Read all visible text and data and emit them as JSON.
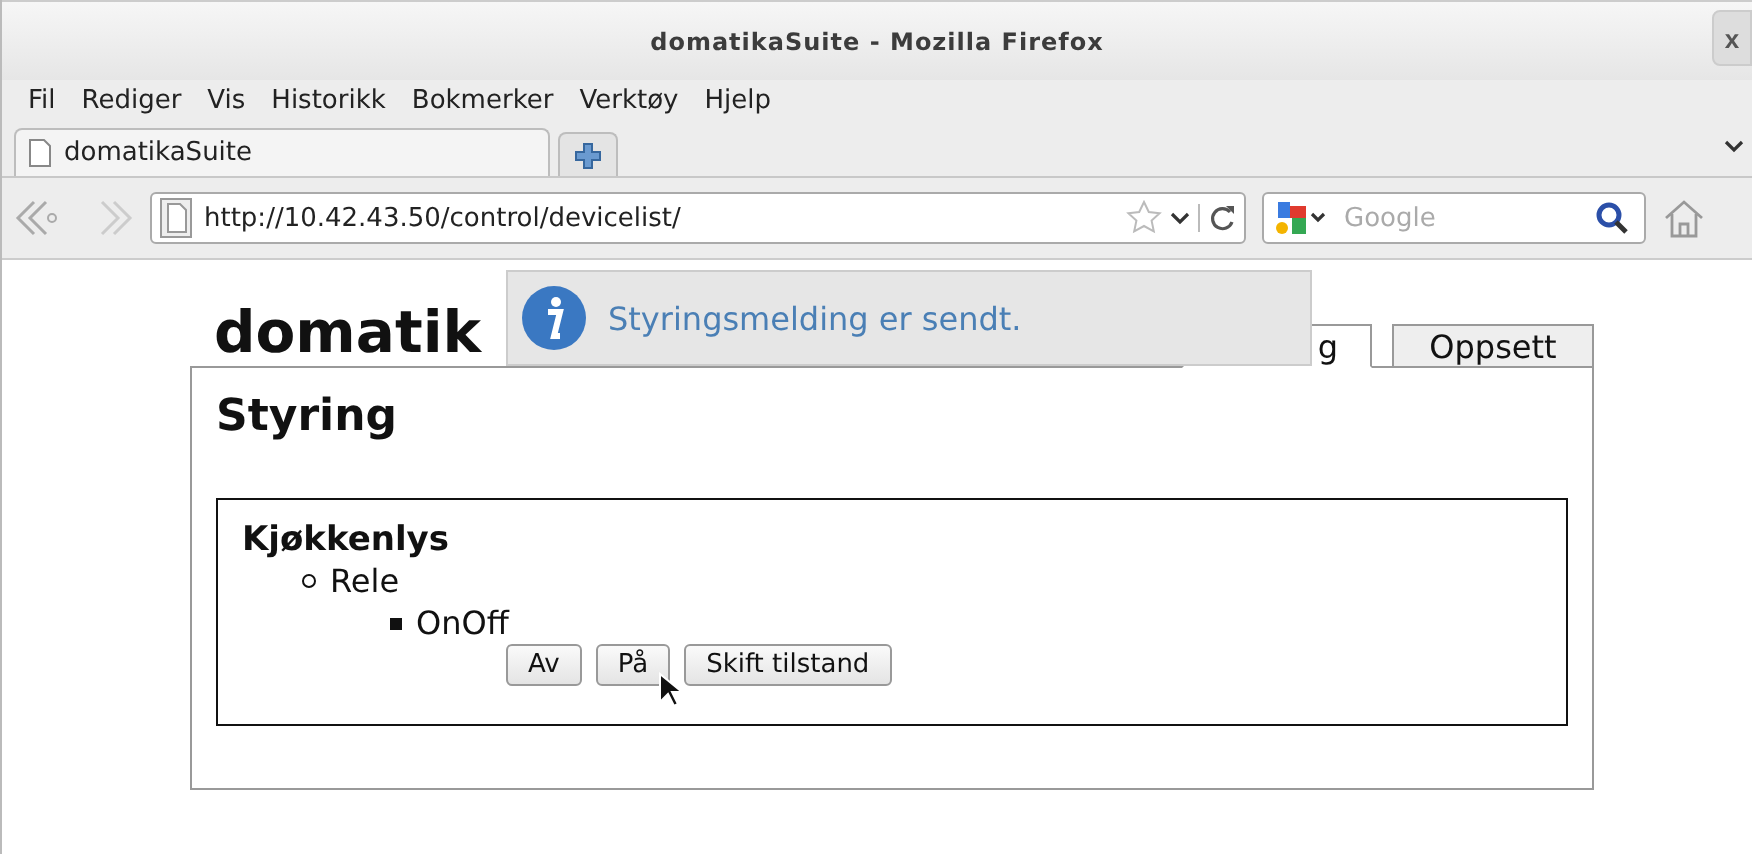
{
  "window": {
    "title": "domatikaSuite - Mozilla Firefox",
    "close": "x"
  },
  "menu": [
    "Fil",
    "Rediger",
    "Vis",
    "Historikk",
    "Bokmerker",
    "Verktøy",
    "Hjelp"
  ],
  "browser_tabs": [
    {
      "label": "domatikaSuite",
      "selected": true
    }
  ],
  "address": {
    "value": "http://10.42.43.50/control/devicelist/"
  },
  "search": {
    "placeholder": "Google"
  },
  "notification": {
    "message": "Styringsmelding er sendt."
  },
  "page": {
    "site_title": "domatik",
    "tabs": [
      {
        "label": "g",
        "selected": true
      },
      {
        "label": "Oppsett",
        "selected": false
      }
    ],
    "heading": "Styring",
    "devices": [
      {
        "name": "Kjøkkenlys",
        "components": [
          {
            "name": "Rele",
            "functions": [
              {
                "name": "OnOff",
                "buttons": [
                  "Av",
                  "På",
                  "Skift tilstand"
                ]
              }
            ]
          }
        ]
      }
    ]
  }
}
